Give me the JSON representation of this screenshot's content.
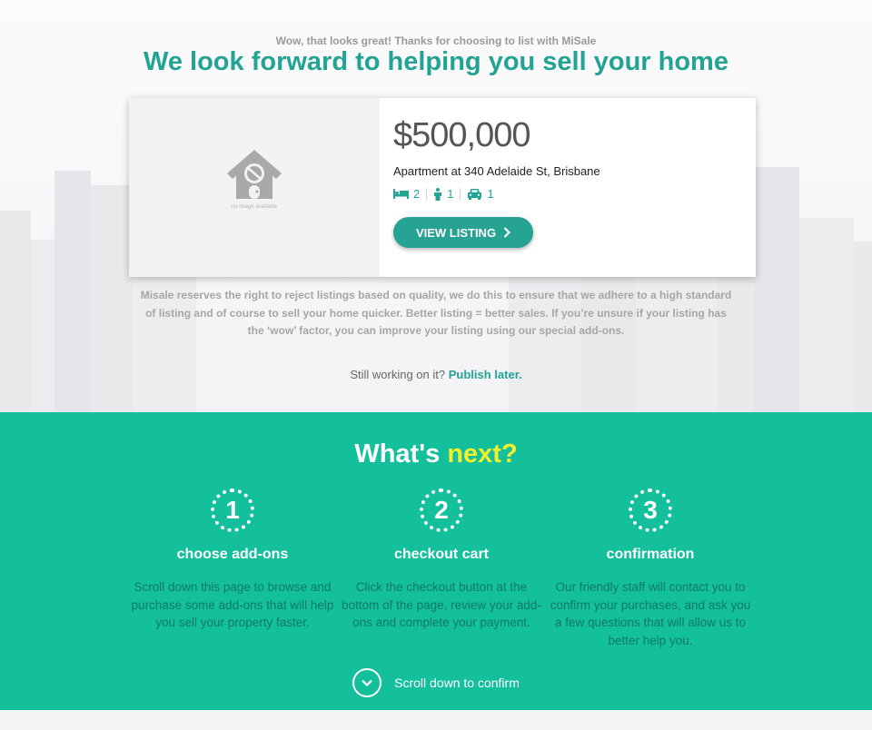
{
  "header": {
    "subtitle": "Wow, that looks great! Thanks for choosing to list with MiSale",
    "headline": "We look forward to helping you sell your home"
  },
  "listing": {
    "image_placeholder_text": "no image available",
    "price": "$500,000",
    "address": "Apartment at 340 Adelaide St, Brisbane",
    "bedrooms": "2",
    "bathrooms": "1",
    "parking": "1",
    "view_button_label": "VIEW LISTING",
    "icons": [
      "bed-icon",
      "person-icon",
      "car-icon",
      "chevron-right-icon",
      "no-image-house-icon"
    ]
  },
  "disclaimer": "Misale reserves the right to reject listings based on quality, we do this to ensure that we adhere to a high standard of listing and of course to sell your home quicker. Better listing = better sales. If you’re unsure if your listing has the ‘wow’ factor, you can improve your listing using our special add-ons.",
  "publish": {
    "prefix": "Still working on it?",
    "link": "Publish later."
  },
  "next": {
    "title_prefix": "What's",
    "title_highlight": "next?",
    "steps": [
      {
        "num": "1",
        "title": "choose add-ons",
        "desc": "Scroll down this page to browse and purchase some add-ons that will help you sell your property faster."
      },
      {
        "num": "2",
        "title": "checkout cart",
        "desc": "Click the checkout button at the bottom of the page, review your add-ons and complete your payment."
      },
      {
        "num": "3",
        "title": "confirmation",
        "desc": "Our friendly staff will contact you to confirm your purchases, and ask you a few questions that will allow us to better help you."
      }
    ],
    "scroll_label": "Scroll down to confirm"
  },
  "colors": {
    "accent": "#22a394",
    "next_bg": "#14bf9c",
    "highlight": "#f1f02b",
    "step_desc": "#0d7a66"
  }
}
